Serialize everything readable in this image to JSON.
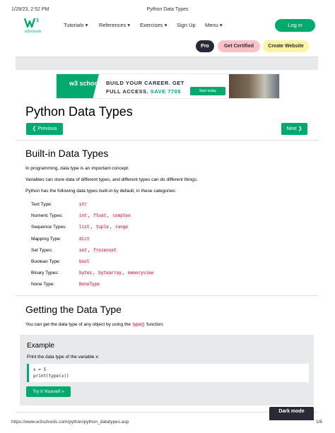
{
  "print_header": {
    "datetime": "1/29/23, 2:52 PM",
    "doc_title": "Python Data Types"
  },
  "nav": {
    "logo_text": "w3schools",
    "logo_mark": "w3",
    "items": [
      {
        "label": "Tutorials ▾"
      },
      {
        "label": "References ▾"
      },
      {
        "label": "Exercises ▾"
      },
      {
        "label": "Sign Up"
      },
      {
        "label": "Menu ▾"
      }
    ],
    "login_label": "Log in"
  },
  "pills": {
    "pro": "Pro",
    "cert": "Get Certified",
    "web": "Create Website"
  },
  "banner": {
    "logo": "w3 schools",
    "line1": "BUILD YOUR CAREER. GET",
    "line2_prefix": "FULL ACCESS. ",
    "line2_save": "SAVE 770$",
    "button": "Start today"
  },
  "page_title": "Python Data Types",
  "prev_label": "❮ Previous",
  "next_label": "Next ❯",
  "section1": {
    "heading": "Built-in Data Types",
    "p1": "In programming, data type is an important concept.",
    "p2": "Variables can store data of different types, and different types can do different things.",
    "p3": "Python has the following data types built-in by default, in these categories:",
    "rows": [
      {
        "label": "Text Type:",
        "values": [
          "str"
        ]
      },
      {
        "label": "Numeric Types:",
        "values": [
          "int",
          "float",
          "complex"
        ]
      },
      {
        "label": "Sequence Types:",
        "values": [
          "list",
          "tuple",
          "range"
        ]
      },
      {
        "label": "Mapping Type:",
        "values": [
          "dict"
        ]
      },
      {
        "label": "Set Types:",
        "values": [
          "set",
          "frozenset"
        ]
      },
      {
        "label": "Boolean Type:",
        "values": [
          "bool"
        ]
      },
      {
        "label": "Binary Types:",
        "values": [
          "bytes",
          "bytearray",
          "memoryview"
        ]
      },
      {
        "label": "None Type:",
        "values": [
          "NoneType"
        ]
      }
    ]
  },
  "section2": {
    "heading": "Getting the Data Type",
    "p_before": "You can get the data type of any object by using the ",
    "p_code": "type()",
    "p_after": " function:"
  },
  "example": {
    "title": "Example",
    "desc": "Print the data type of the variable x:",
    "code_line1": "x = 5",
    "code_line2": "print(type(x))",
    "try_label": "Try it Yourself »"
  },
  "dark_mode_label": "Dark mode",
  "footer": {
    "url": "https://www.w3schools.com/python/python_datatypes.asp",
    "page": "1/6"
  },
  "colors": {
    "accent": "#04aa6d",
    "dark": "#282a35",
    "code_red": "#dc143c",
    "pink": "#ffc0c7",
    "yellow": "#fff4a3"
  }
}
